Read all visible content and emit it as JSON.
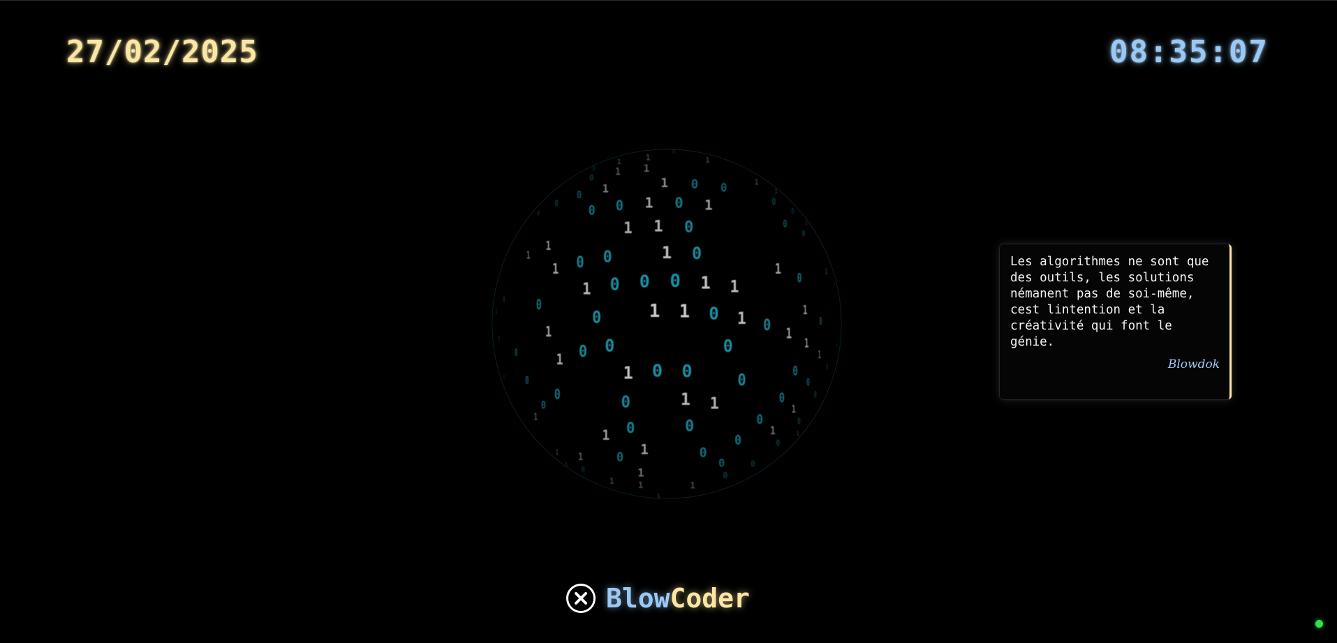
{
  "header": {
    "date": "27/02/2025",
    "time": "08:35:07"
  },
  "globe": {
    "glyphs": [
      "0",
      "1"
    ],
    "colors": {
      "zero": "#1ea0b4",
      "one": "#d8d8d8"
    }
  },
  "quote": {
    "text": "Les algorithmes ne sont que des outils, les solutions némanent pas de soi-même, cest lintention et la créativité qui font le génie.",
    "author": "Blowdok"
  },
  "brand": {
    "name_part1": "Blow",
    "name_part2": "Coder",
    "logo_icon": "circle-x-icon"
  },
  "status": {
    "indicator_color": "#33e04a"
  },
  "theme": {
    "date_color": "#fbe6a4",
    "time_color": "#9bc9f5",
    "background": "#000000"
  }
}
